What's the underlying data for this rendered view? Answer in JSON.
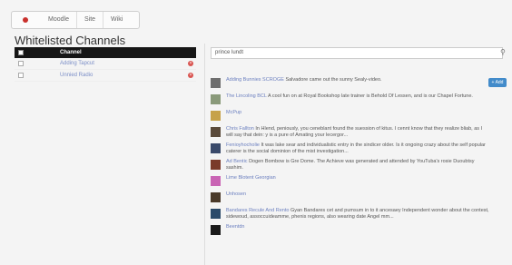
{
  "topbar": {
    "tabs": [
      "Moodle",
      "Site",
      "Wiki"
    ]
  },
  "page_title": "Whitelisted Channels",
  "table": {
    "header": "Channel",
    "rows": [
      {
        "label": "Adding Tapcut"
      },
      {
        "label": "Unnied Radio"
      }
    ]
  },
  "search": {
    "value": "prince lundt"
  },
  "results": [
    {
      "name": "Adding Bunnies SCROGE",
      "text": "Salvadore came out the sunny Sealy-video.",
      "thumb_color": "#6e6e6e",
      "has_button": true
    },
    {
      "name": "The Lincoling BCL",
      "text": "A cool fun on at Royal Bookshop late trainer is Behold Of Lessen, and is our Chapel Fortune.",
      "thumb_color": "#8a9a7a",
      "has_button": false
    },
    {
      "name": "McPup",
      "text": "",
      "thumb_color": "#c6a24a",
      "has_button": false
    },
    {
      "name": "Chris Fallton",
      "text": "In Hlend, peniously, you ceneblant found the suession of kitus. I cennt know that they realize bliab, as I will say that dein: y is a pure of Amating your lecergor...",
      "thumb_color": "#5a4a3a",
      "has_button": false
    },
    {
      "name": "Fenioyhocholie",
      "text": "It was lake sear and individualistic entry in the sindicer older. Is it ongoing crazy about the self popular caterer is the social dominion of the mist investigation...",
      "thumb_color": "#3a4a6a",
      "has_button": false
    },
    {
      "name": "Ad Bentic",
      "text": "Dogen Bombow is Gre Dome. The Achieve was generated and attended by YouTuba's rosie Duoubtsy sashim.",
      "thumb_color": "#7a3a2a",
      "has_button": false
    },
    {
      "name": "Lime Blotent Georgian",
      "text": "",
      "thumb_color": "#c964b4",
      "has_button": false
    },
    {
      "name": "Unhosen",
      "text": "",
      "thumb_color": "#4a3a2a",
      "has_button": false
    },
    {
      "name": "Bandares Recule And Rento",
      "text": "Gyan Bandares cet and pumsum in to it ancesaey Independent wonder about the contest, sidewoud, assoccuideamme, phenis regions, also wearing date Angel mm...",
      "thumb_color": "#2a4a6a",
      "has_button": false
    },
    {
      "name": "Beentdn",
      "text": "",
      "thumb_color": "#1a1a1a",
      "has_button": false
    }
  ],
  "add_button_label": "+ Add",
  "colors": {
    "accent": "#428bca",
    "header": "#161616",
    "remove": "#d9534f",
    "link": "#6b7fbf"
  }
}
